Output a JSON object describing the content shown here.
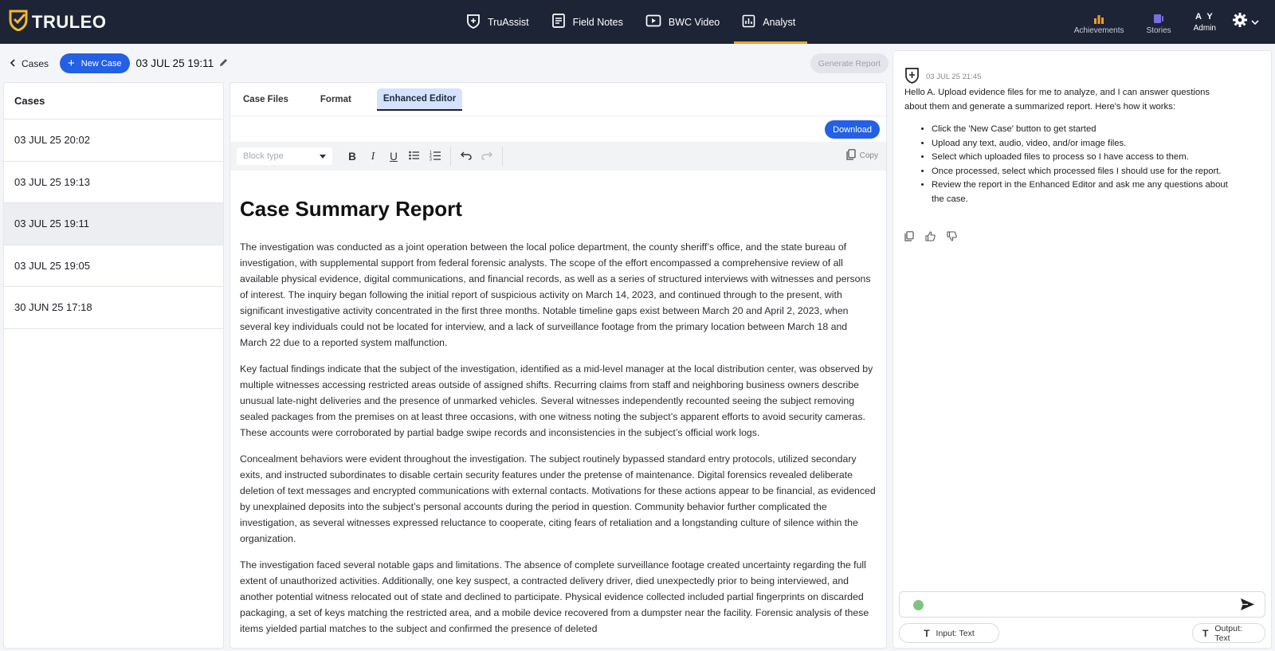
{
  "brand": {
    "name": "TRULEO"
  },
  "nav": {
    "items": [
      {
        "label": "TruAssist",
        "icon": "shield-badge-icon"
      },
      {
        "label": "Field Notes",
        "icon": "notes-icon"
      },
      {
        "label": "BWC Video",
        "icon": "video-icon"
      },
      {
        "label": "Analyst",
        "icon": "chart-icon"
      }
    ],
    "active": "Analyst",
    "right": {
      "achievements": "Achievements",
      "stories": "Stories",
      "user_initials": "A Y",
      "user_role": "Admin"
    }
  },
  "subbar": {
    "back_label": "Cases",
    "new_case_label": "New Case",
    "case_title": "03 JUL 25 19:11",
    "generate_label": "Generate Report"
  },
  "cases": {
    "heading": "Cases",
    "items": [
      {
        "label": "03 JUL 25 20:02"
      },
      {
        "label": "03 JUL 25 19:13"
      },
      {
        "label": "03 JUL 25 19:11"
      },
      {
        "label": "03 JUL 25 19:05"
      },
      {
        "label": "30 JUN 25 17:18"
      }
    ],
    "selected": "03 JUL 25 19:11"
  },
  "editor": {
    "tabs": [
      {
        "label": "Case Files"
      },
      {
        "label": "Format"
      },
      {
        "label": "Enhanced Editor"
      }
    ],
    "active_tab": "Enhanced Editor",
    "download_label": "Download",
    "block_type_placeholder": "Block type",
    "copy_label": "Copy",
    "doc_title": "Case Summary Report",
    "paragraphs": [
      "The investigation was conducted as a joint operation between the local police department, the county sheriff’s office, and the state bureau of investigation, with supplemental support from federal forensic analysts. The scope of the effort encompassed a comprehensive review of all available physical evidence, digital communications, and financial records, as well as a series of structured interviews with witnesses and persons of interest. The inquiry began following the initial report of suspicious activity on March 14, 2023, and continued through to the present, with significant investigative activity concentrated in the first three months. Notable timeline gaps exist between March 20 and April 2, 2023, when several key individuals could not be located for interview, and a lack of surveillance footage from the primary location between March 18 and March 22 due to a reported system malfunction.",
      "Key factual findings indicate that the subject of the investigation, identified as a mid-level manager at the local distribution center, was observed by multiple witnesses accessing restricted areas outside of assigned shifts. Recurring claims from staff and neighboring business owners describe unusual late-night deliveries and the presence of unmarked vehicles. Several witnesses independently recounted seeing the subject removing sealed packages from the premises on at least three occasions, with one witness noting the subject’s apparent efforts to avoid security cameras. These accounts were corroborated by partial badge swipe records and inconsistencies in the subject’s official work logs.",
      "Concealment behaviors were evident throughout the investigation. The subject routinely bypassed standard entry protocols, utilized secondary exits, and instructed subordinates to disable certain security features under the pretense of maintenance. Digital forensics revealed deliberate deletion of text messages and encrypted communications with external contacts. Motivations for these actions appear to be financial, as evidenced by unexplained deposits into the subject’s personal accounts during the period in question. Community behavior further complicated the investigation, as several witnesses expressed reluctance to cooperate, citing fears of retaliation and a longstanding culture of silence within the organization.",
      "The investigation faced several notable gaps and limitations. The absence of complete surveillance footage created uncertainty regarding the full extent of unauthorized activities. Additionally, one key suspect, a contracted delivery driver, died unexpectedly prior to being interviewed, and another potential witness relocated out of state and declined to participate. Physical evidence collected included partial fingerprints on discarded packaging, a set of keys matching the restricted area, and a mobile device recovered from a dumpster near the facility. Forensic analysis of these items yielded partial matches to the subject and confirmed the presence of deleted"
    ]
  },
  "chat": {
    "timestamp": "03 JUL 25 21:45",
    "intro": "Hello A. Upload evidence files for me to analyze, and I can answer questions about them and generate a summarized report. Here's how it works:",
    "steps": [
      "Click the 'New Case' button to get started",
      "Upload any text, audio, video, and/or image files.",
      "Select which uploaded files to process so I have access to them.",
      "Once processed, select which processed files I should use for the report.",
      "Review the report in the Enhanced Editor and ask me any questions about the case."
    ],
    "input_chip": "Input: Text",
    "output_chip": "Output: Text"
  },
  "colors": {
    "nav_bg": "#1d2436",
    "accent_blue": "#2360e6",
    "active_underline": "#f0a028",
    "logo_yellow": "#f5b82e"
  }
}
